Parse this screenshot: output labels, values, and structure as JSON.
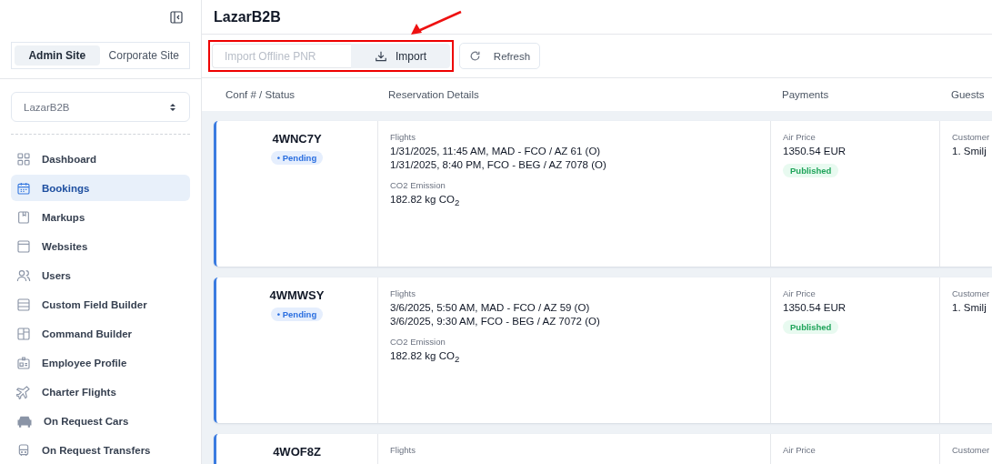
{
  "sidebar": {
    "site_tabs": [
      {
        "label": "Admin Site",
        "selected": true
      },
      {
        "label": "Corporate Site",
        "selected": false
      }
    ],
    "account_select": {
      "value": "LazarB2B"
    },
    "items": [
      {
        "label": "Dashboard",
        "selected": false
      },
      {
        "label": "Bookings",
        "selected": true
      },
      {
        "label": "Markups",
        "selected": false
      },
      {
        "label": "Websites",
        "selected": false
      },
      {
        "label": "Users",
        "selected": false
      },
      {
        "label": "Custom Field Builder",
        "selected": false
      },
      {
        "label": "Command Builder",
        "selected": false
      },
      {
        "label": "Employee Profile",
        "selected": false
      },
      {
        "label": "Charter Flights",
        "selected": false
      },
      {
        "label": "On Request Cars",
        "selected": false
      },
      {
        "label": "On Request Transfers",
        "selected": false
      }
    ]
  },
  "header": {
    "title": "LazarB2B"
  },
  "toolbar": {
    "pnr_field": {
      "placeholder": "Import Offline PNR"
    },
    "import_button": "Import",
    "refresh_button": "Refresh",
    "annotation": {
      "highlight": true,
      "arrow": true
    }
  },
  "table": {
    "columns": [
      "Conf # / Status",
      "Reservation Details",
      "Payments",
      "Guests"
    ],
    "rows": [
      {
        "conf": "4WNC7Y",
        "status": "• Pending",
        "flights_label": "Flights",
        "flights": [
          "1/31/2025, 11:45 AM, MAD - FCO / AZ 61 (O)",
          "1/31/2025, 8:40 PM, FCO - BEG / AZ 7078 (O)"
        ],
        "co2_label": "CO2 Emission",
        "co2": "182.82 kg CO$_{2}$",
        "price_label": "Air Price",
        "price": "1350.54 EUR",
        "payment_status": "Published",
        "guests_label": "Customer",
        "guests": [
          "1. Smilj"
        ]
      },
      {
        "conf": "4WMWSY",
        "status": "• Pending",
        "flights_label": "Flights",
        "flights": [
          "3/6/2025, 5:50 AM, MAD - FCO / AZ 59 (O)",
          "3/6/2025, 9:30 AM, FCO - BEG / AZ 7072 (O)"
        ],
        "co2_label": "CO2 Emission",
        "co2": "182.82 kg CO$_{2}$",
        "price_label": "Air Price",
        "price": "1350.54 EUR",
        "payment_status": "Published",
        "guests_label": "Customer",
        "guests": [
          "1. Smilj"
        ]
      },
      {
        "conf": "4WOF8Z",
        "flights_label": "Flights",
        "price_label": "Air Price",
        "guests_label": "Customer"
      }
    ]
  }
}
